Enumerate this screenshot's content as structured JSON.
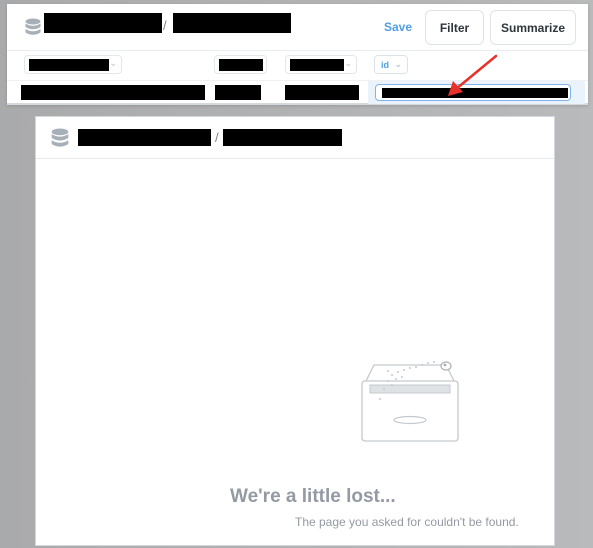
{
  "top_panel": {
    "breadcrumb_separator": "/",
    "save_label": "Save",
    "filter_label": "Filter",
    "summarize_label": "Summarize",
    "id_column_label": "id",
    "icons": [
      "database-icon",
      "chevron-down-icon"
    ]
  },
  "main_window": {
    "breadcrumb_separator": "/",
    "error_title": "We're a little lost...",
    "error_message": "The page you asked for couldn't be found.",
    "icons": [
      "database-icon",
      "empty-box-illustration"
    ]
  },
  "annotation": {
    "arrow_color": "#e8312a"
  },
  "colors": {
    "accent": "#509ee3",
    "muted_text": "#949aa3"
  }
}
